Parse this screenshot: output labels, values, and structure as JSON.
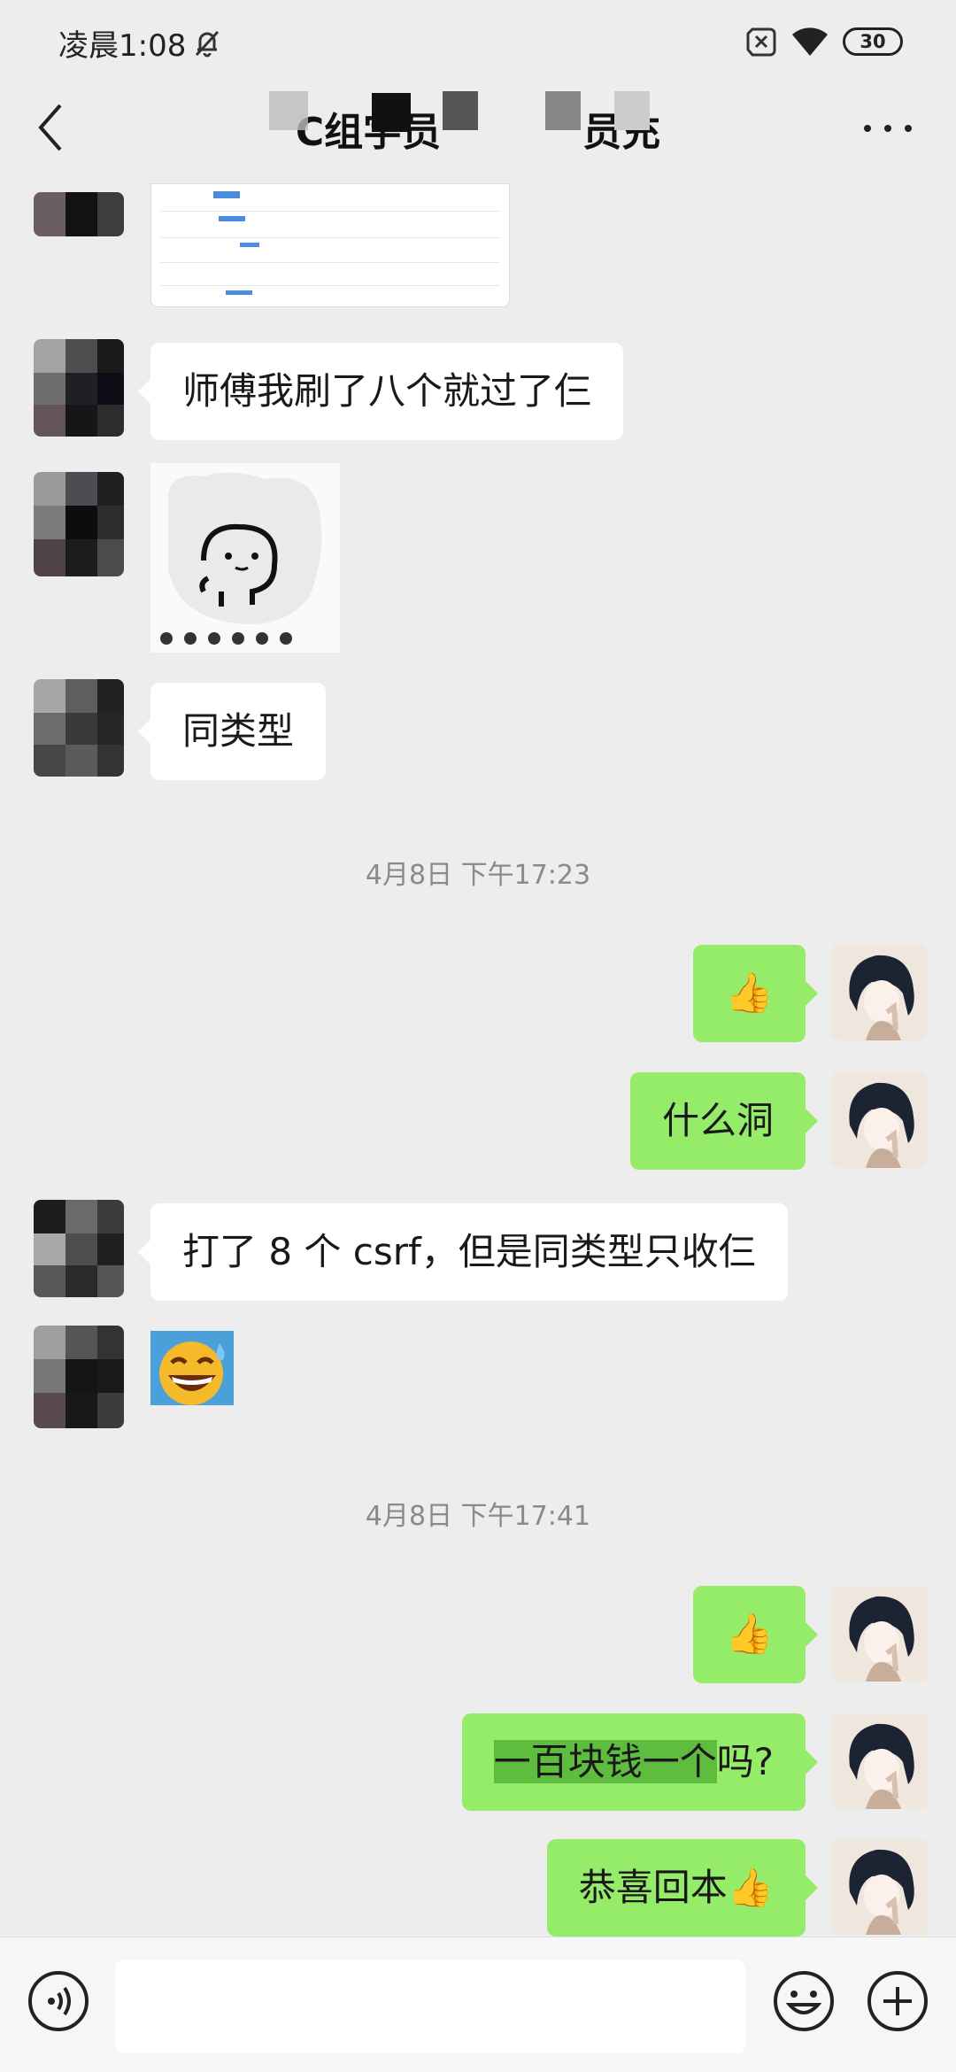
{
  "status_bar": {
    "time": "凌晨1:08",
    "battery": "30"
  },
  "header": {
    "title": "C组字员",
    "title_suffix": "员充"
  },
  "messages": {
    "m1": "师傅我刷了八个就过了仨",
    "m2": "同类型",
    "t1": "4月8日 下午17:23",
    "m3": "👍",
    "m4": "什么洞",
    "m5": "打了 8 个 csrf，但是同类型只收仨",
    "m6": "😅",
    "t2": "4月8日 下午17:41",
    "m7": "👍",
    "m8_highlight": "一百块钱一个",
    "m8_rest": "吗?",
    "m9": "恭喜回本👍"
  },
  "input": {
    "placeholder": ""
  },
  "colors": {
    "sent_bubble": "#95ec69",
    "received_bubble": "#ffffff",
    "background": "#ededed"
  }
}
